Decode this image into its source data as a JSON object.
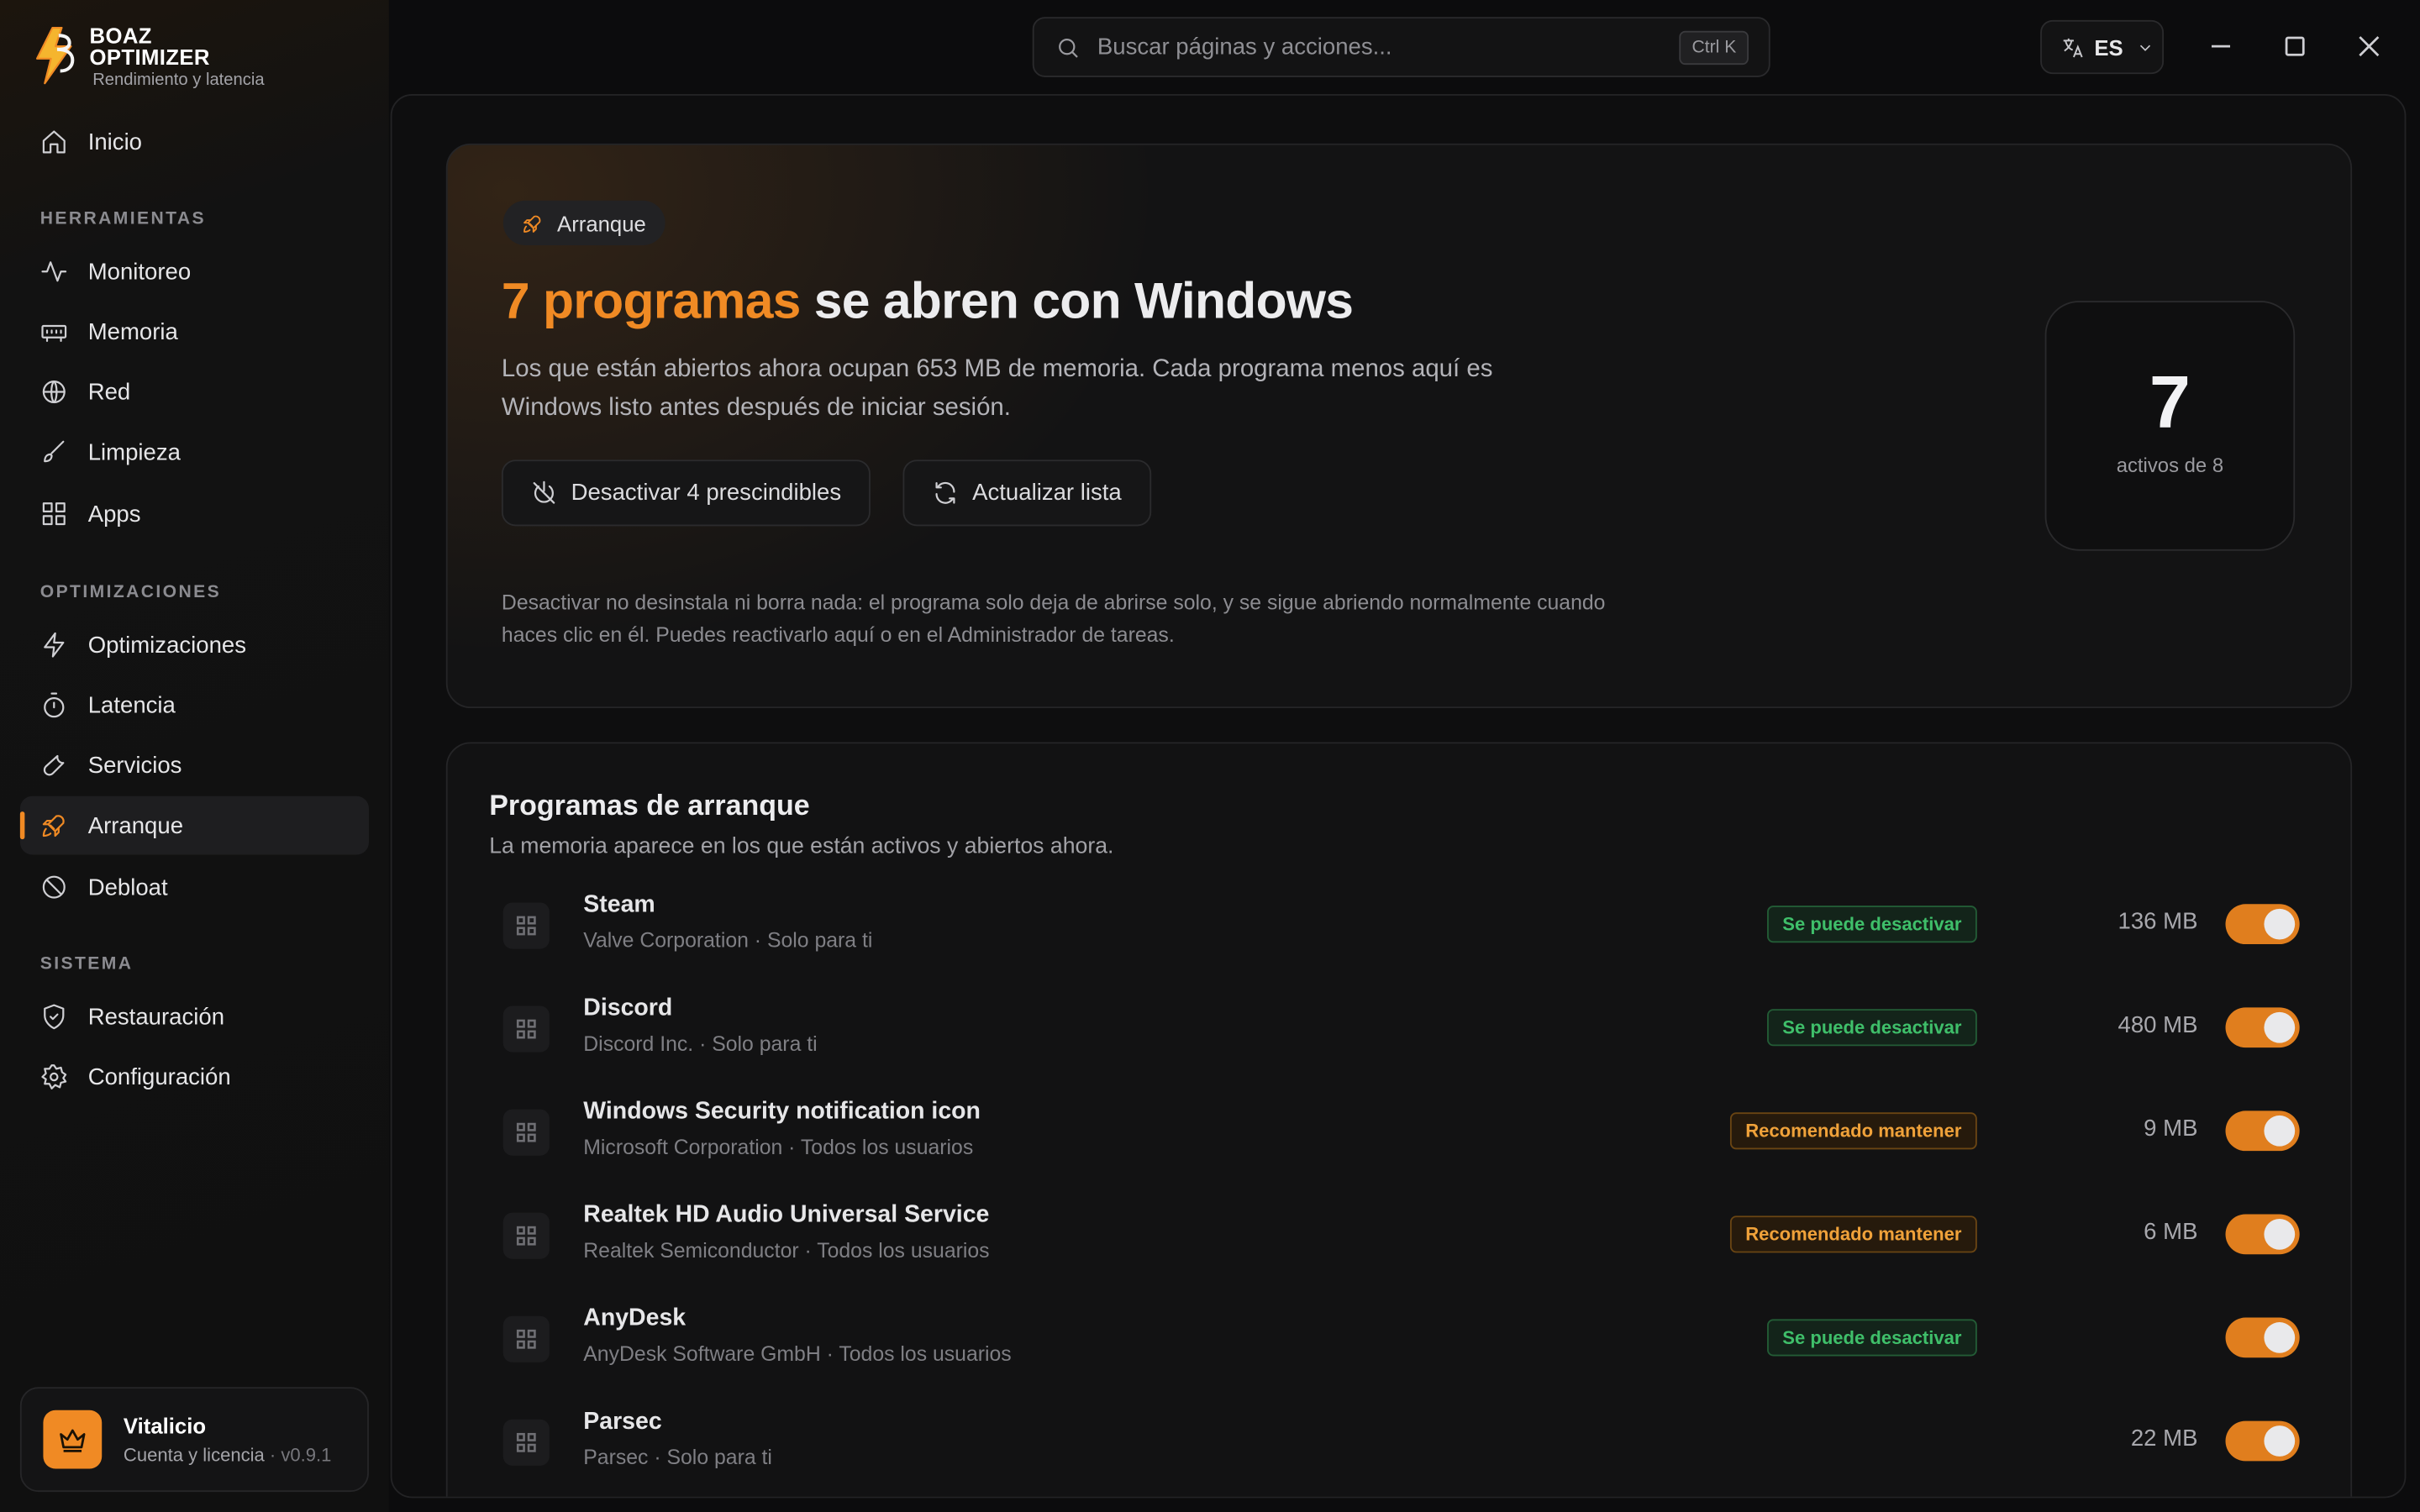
{
  "brand": {
    "line1": "BOAZ",
    "line2": "OPTIMIZER",
    "tagline": "Rendimiento y latencia",
    "accent": "#f08a24"
  },
  "sidebar": {
    "home": {
      "label": "Inicio",
      "icon": "home-icon"
    },
    "sections": [
      {
        "title": "HERRAMIENTAS",
        "items": [
          {
            "label": "Monitoreo",
            "icon": "activity-icon"
          },
          {
            "label": "Memoria",
            "icon": "memory-icon"
          },
          {
            "label": "Red",
            "icon": "globe-icon"
          },
          {
            "label": "Limpieza",
            "icon": "brush-icon"
          },
          {
            "label": "Apps",
            "icon": "apps-grid-icon"
          }
        ]
      },
      {
        "title": "OPTIMIZACIONES",
        "items": [
          {
            "label": "Optimizaciones",
            "icon": "bolt-icon"
          },
          {
            "label": "Latencia",
            "icon": "timer-icon"
          },
          {
            "label": "Servicios",
            "icon": "wrench-icon"
          },
          {
            "label": "Arranque",
            "icon": "rocket-icon",
            "active": true
          },
          {
            "label": "Debloat",
            "icon": "ban-icon"
          }
        ]
      },
      {
        "title": "SISTEMA",
        "items": [
          {
            "label": "Restauración",
            "icon": "shield-check-icon"
          },
          {
            "label": "Configuración",
            "icon": "gear-icon"
          }
        ]
      }
    ],
    "account": {
      "plan": "Vitalicio",
      "subtitle": "Cuenta y licencia",
      "version": "· v0.9.1",
      "icon": "crown-icon"
    }
  },
  "topbar": {
    "search_placeholder": "Buscar páginas y acciones...",
    "shortcut": "Ctrl K",
    "language": "ES"
  },
  "hero": {
    "pill": "Arranque",
    "headline_highlight": "7 programas",
    "headline_rest": " se abren con Windows",
    "description": "Los que están abiertos ahora ocupan 653 MB de memoria. Cada programa menos aquí es Windows listo antes después de iniciar sesión.",
    "disable_button": "Desactivar 4 prescindibles",
    "refresh_button": "Actualizar lista",
    "note": "Desactivar no desinstala ni borra nada: el programa solo deja de abrirse solo, y se sigue abriendo normalmente cuando haces clic en él. Puedes reactivarlo aquí o en el Administrador de tareas.",
    "count_value": "7",
    "count_label": "activos de 8"
  },
  "startup_list": {
    "title": "Programas de arranque",
    "subtitle": "La memoria aparece en los que están activos y abiertos ahora.",
    "items": [
      {
        "name": "Steam",
        "publisher": "Valve Corporation · Solo para ti",
        "badge": "Se puede desactivar",
        "badge_type": "ok",
        "memory": "136 MB",
        "enabled": true
      },
      {
        "name": "Discord",
        "publisher": "Discord Inc. · Solo para ti",
        "badge": "Se puede desactivar",
        "badge_type": "ok",
        "memory": "480 MB",
        "enabled": true
      },
      {
        "name": "Windows Security notification icon",
        "publisher": "Microsoft Corporation · Todos los usuarios",
        "badge": "Recomendado mantener",
        "badge_type": "keep",
        "memory": "9 MB",
        "enabled": true
      },
      {
        "name": "Realtek HD Audio Universal Service",
        "publisher": "Realtek Semiconductor · Todos los usuarios",
        "badge": "Recomendado mantener",
        "badge_type": "keep",
        "memory": "6 MB",
        "enabled": true
      },
      {
        "name": "AnyDesk",
        "publisher": "AnyDesk Software GmbH · Todos los usuarios",
        "badge": "Se puede desactivar",
        "badge_type": "ok",
        "memory": "",
        "enabled": true
      },
      {
        "name": "Parsec",
        "publisher": "Parsec · Solo para ti",
        "badge": "",
        "badge_type": "",
        "memory": "22 MB",
        "enabled": true
      }
    ]
  }
}
